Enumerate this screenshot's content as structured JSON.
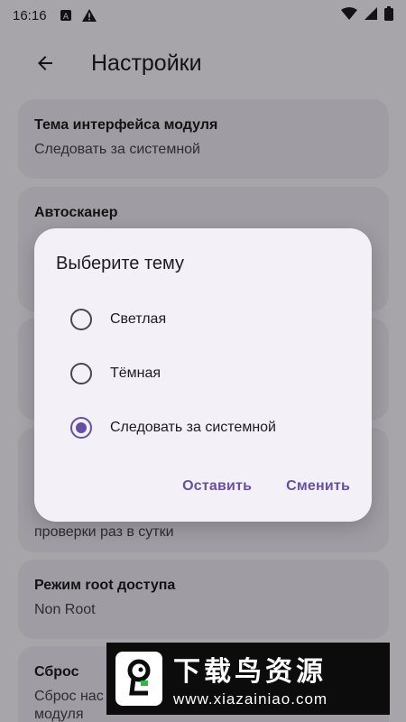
{
  "status_bar": {
    "time": "16:16"
  },
  "app_bar": {
    "title": "Настройки"
  },
  "settings": [
    {
      "title": "Тема интерфейса модуля",
      "subtitle": "Следовать за системной"
    },
    {
      "title": "Автосканер",
      "subtitle": ""
    },
    {
      "title": "",
      "subtitle": ""
    },
    {
      "title": "",
      "subtitle": "проверки раз в сутки"
    },
    {
      "title": "Режим root доступа",
      "subtitle": "Non Root"
    },
    {
      "title": "Сброс",
      "subtitle": "Сброс нас",
      "subtitle2": "модуля"
    }
  ],
  "dialog": {
    "title": "Выберите тему",
    "options": [
      {
        "label": "Светлая",
        "selected": false
      },
      {
        "label": "Тёмная",
        "selected": false
      },
      {
        "label": "Следовать за системной",
        "selected": true
      }
    ],
    "cancel_label": "Оставить",
    "confirm_label": "Сменить"
  },
  "watermark": {
    "brand": "下载鸟资源",
    "url": "www.xiazainiao.com"
  },
  "colors": {
    "accent": "#6750a4",
    "card_bg": "#ebe6f1",
    "dialog_bg": "#f3f0f8"
  }
}
